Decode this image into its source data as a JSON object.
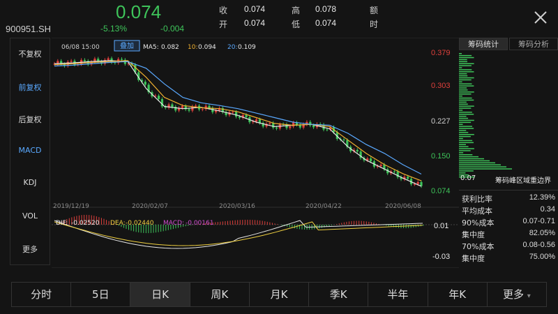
{
  "header": {
    "code": "900951.SH",
    "price": "0.074",
    "change_pct": "-5.13%",
    "change": "-0.004",
    "quote": {
      "close_label": "收",
      "close_value": "0.074",
      "open_label": "开",
      "open_value": "0.074",
      "high_label": "高",
      "high_value": "0.078",
      "low_label": "低",
      "low_value": "0.074",
      "amount_label_1": "额",
      "amount_label_2": "时"
    }
  },
  "left_panel": [
    {
      "label": "不复权",
      "active": false
    },
    {
      "label": "前复权",
      "active": true
    },
    {
      "label": "后复权",
      "active": false
    },
    {
      "label": "MACD",
      "active": true
    },
    {
      "label": "KDJ",
      "active": false
    },
    {
      "label": "VOL",
      "active": false
    },
    {
      "label": "更多",
      "active": false
    }
  ],
  "chart_header": {
    "datetime": "06/08 15:00",
    "overlay_button": "叠加",
    "ma5_label": "MA5:",
    "ma5_value": "0.082",
    "ma10_label": "10:",
    "ma10_value": "0.094",
    "ma20_label": "20:",
    "ma20_value": "0.109"
  },
  "price_axis": [
    "0.379",
    "0.303",
    "0.227",
    "0.150",
    "0.074"
  ],
  "date_axis": [
    "2019/12/19",
    "2020/02/07",
    "2020/03/16",
    "2020/04/22",
    "2020/06/08"
  ],
  "macd": {
    "dif_label": "DIF:",
    "dif_value": "-0.02520",
    "dea_label": "DEA:",
    "dea_value": "-0.02440",
    "macd_label": "MACD:",
    "macd_value": "-0.00161",
    "axis_top": "0.01",
    "axis_bottom": "-0.03"
  },
  "right_panel": {
    "tab1": "筹码统计",
    "tab2": "筹码分析",
    "min_label": "0.07",
    "peak_label": "筹码峰区域重边界",
    "rows": [
      {
        "label": "获利比率",
        "value": "12.39%"
      },
      {
        "label": "平均成本",
        "value": "0.34"
      },
      {
        "label": "90%成本",
        "value": "0.07-0.71"
      },
      {
        "label": "集中度",
        "value": "82.05%"
      },
      {
        "label": "70%成本",
        "value": "0.08-0.56"
      },
      {
        "label": "集中度",
        "value": "75.00%"
      }
    ]
  },
  "bottom_tabs": [
    {
      "label": "分时",
      "active": false
    },
    {
      "label": "5日",
      "active": false
    },
    {
      "label": "日K",
      "active": true
    },
    {
      "label": "周K",
      "active": false
    },
    {
      "label": "月K",
      "active": false
    },
    {
      "label": "季K",
      "active": false
    },
    {
      "label": "半年",
      "active": false
    },
    {
      "label": "年K",
      "active": false
    },
    {
      "label": "更多",
      "active": false
    }
  ],
  "colors": {
    "up": "#e0403c",
    "down": "#3ec45a",
    "ma5": "#e8e8e8",
    "ma10": "#f0b030",
    "ma20": "#5aa9ff",
    "macd_label": "#d050d0"
  },
  "chart_data": {
    "type": "line",
    "series": [
      {
        "name": "MA5",
        "values": [
          0.355,
          0.357,
          0.36,
          0.362,
          0.36,
          0.3,
          0.26,
          0.255,
          0.258,
          0.25,
          0.24,
          0.225,
          0.215,
          0.218,
          0.22,
          0.21,
          0.17,
          0.14,
          0.12,
          0.1,
          0.082
        ]
      },
      {
        "name": "10",
        "values": [
          0.353,
          0.355,
          0.358,
          0.36,
          0.362,
          0.325,
          0.28,
          0.262,
          0.257,
          0.255,
          0.248,
          0.235,
          0.222,
          0.218,
          0.22,
          0.215,
          0.185,
          0.155,
          0.13,
          0.11,
          0.094
        ]
      },
      {
        "name": "20",
        "values": [
          0.35,
          0.352,
          0.355,
          0.358,
          0.36,
          0.345,
          0.31,
          0.28,
          0.268,
          0.262,
          0.255,
          0.245,
          0.235,
          0.225,
          0.22,
          0.218,
          0.2,
          0.175,
          0.155,
          0.13,
          0.109
        ]
      }
    ],
    "ylim": [
      0.074,
      0.379
    ],
    "yticks": [
      0.379,
      0.303,
      0.227,
      0.15,
      0.074
    ],
    "xticks": [
      "2019/12/19",
      "2020/02/07",
      "2020/03/16",
      "2020/04/22",
      "2020/06/08"
    ]
  }
}
